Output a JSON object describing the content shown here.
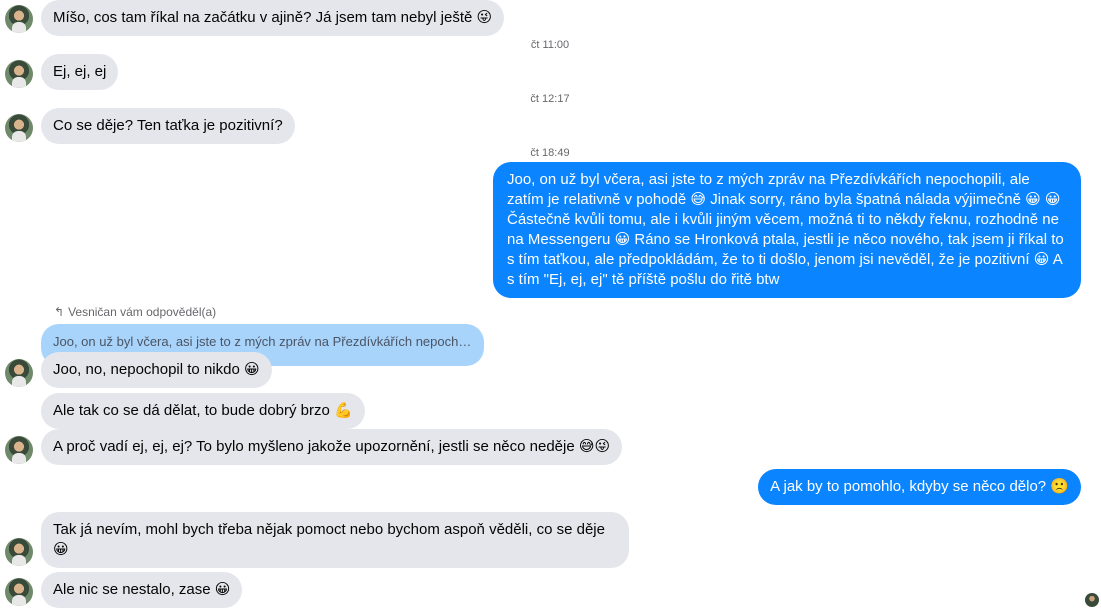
{
  "messages": {
    "m1": "Míšo, cos tam říkal na začátku v ajině? Já jsem tam nebyl ještě 😜",
    "t1": "čt 11:00",
    "m2": "Ej, ej, ej",
    "t2": "čt 12:17",
    "m3": "Co se děje? Ten taťka je pozitivní?",
    "t3": "čt 18:49",
    "m4": "Joo, on už byl včera, asi jste to z mých zpráv na Přezdívkářích nepochopili, ale zatím je relativně v pohodě 😅 Jinak sorry, ráno byla špatná nálada výjimečně 😀 😀 Částečně kvůli tomu, ale i kvůli jiným věcem, možná ti to někdy řeknu, rozhodně ne na Messengeru 😀 Ráno se Hronková ptala, jestli je něco nového, tak jsem ji říkal to s tím taťkou, ale předpokládám, že to ti došlo, jenom jsi nevěděl, že je pozitivní 😀 A s tím \"Ej, ej, ej\" tě příště pošlu do řitě btw",
    "reply_label": "Vesničan vám odpověděl(a)",
    "quoted": "Joo, on už byl včera, asi jste to z mých zpráv na Přezdívkářích nepochop...",
    "m5": "Joo, no, nepochopil to nikdo 😀",
    "m6": "Ale tak co se dá dělat, to bude dobrý brzo 💪",
    "m7": "A proč vadí ej, ej, ej? To bylo myšleno jakože upozornění, jestli se něco neděje 😅😜",
    "m8": "A jak by to pomohlo, kdyby se něco dělo? 🙁",
    "m9": "Tak já nevím, mohl bych třeba nějak pomoct nebo bychom aspoň věděli, co se děje 😀",
    "m10": "Ale nic se nestalo, zase 😀"
  },
  "colors": {
    "incoming_bubble": "#e4e6eb",
    "outgoing_bubble": "#0a84ff",
    "quoted_bubble": "#a8d3fb"
  },
  "icons": {
    "reply": "reply-icon",
    "avatar": "avatar"
  }
}
